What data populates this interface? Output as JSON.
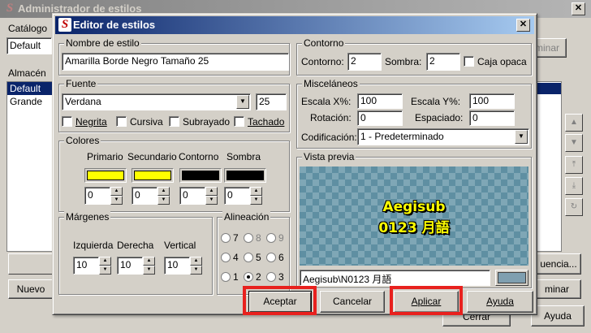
{
  "back_window": {
    "title": "Administrador de estilos",
    "catalog_label": "Catálogo",
    "catalog_value": "Default",
    "storage_label": "Almacén",
    "storage_items": [
      "Default",
      "Grande"
    ],
    "delete_btn": "minar",
    "manager_btn": "uencia...",
    "delete_btn2": "minar",
    "new_btn": "Nuevo",
    "close_btn": "Cerrar",
    "help_btn": "Ayuda"
  },
  "dialog": {
    "title": "Editor de estilos",
    "style_name": {
      "label": "Nombre de estilo",
      "value": "Amarilla Borde Negro Tamaño 25"
    },
    "font": {
      "label": "Fuente",
      "family": "Verdana",
      "size": "25",
      "bold": "Negrita",
      "italic": "Cursiva",
      "underline": "Subrayado",
      "strike": "Tachado"
    },
    "colors": {
      "label": "Colores",
      "columns": [
        {
          "name": "Primario",
          "color": "#ffff00",
          "alpha": "0"
        },
        {
          "name": "Secundario",
          "color": "#ffff00",
          "alpha": "0"
        },
        {
          "name": "Contorno",
          "color": "#000000",
          "alpha": "0"
        },
        {
          "name": "Sombra",
          "color": "#000000",
          "alpha": "0"
        }
      ]
    },
    "margins": {
      "label": "Márgenes",
      "left_label": "Izquierda",
      "left": "10",
      "right_label": "Derecha",
      "right": "10",
      "vertical_label": "Vertical",
      "vertical": "10"
    },
    "alignment": {
      "label": "Alineación",
      "options": [
        "7",
        "8",
        "9",
        "4",
        "5",
        "6",
        "1",
        "2",
        "3"
      ],
      "selected": "2"
    },
    "outline": {
      "label": "Contorno",
      "outline_label": "Contorno:",
      "outline_value": "2",
      "shadow_label": "Sombra:",
      "shadow_value": "2",
      "opaque_label": "Caja opaca"
    },
    "misc": {
      "label": "Misceláneos",
      "scale_x_label": "Escala X%:",
      "scale_x": "100",
      "scale_y_label": "Escala Y%:",
      "scale_y": "100",
      "rotation_label": "Rotación:",
      "rotation": "0",
      "spacing_label": "Espaciado:",
      "spacing": "0",
      "encoding_label": "Codificación:",
      "encoding": "1 - Predeterminado"
    },
    "preview": {
      "label": "Vista previa",
      "line1": "Aegisub",
      "line2": "0123 月語",
      "text_value": "Aegisub\\N0123 月語",
      "bg_color": "#7f9fb0"
    },
    "buttons": {
      "accept": "Aceptar",
      "cancel": "Cancelar",
      "apply": "Aplicar",
      "help": "Ayuda"
    }
  }
}
